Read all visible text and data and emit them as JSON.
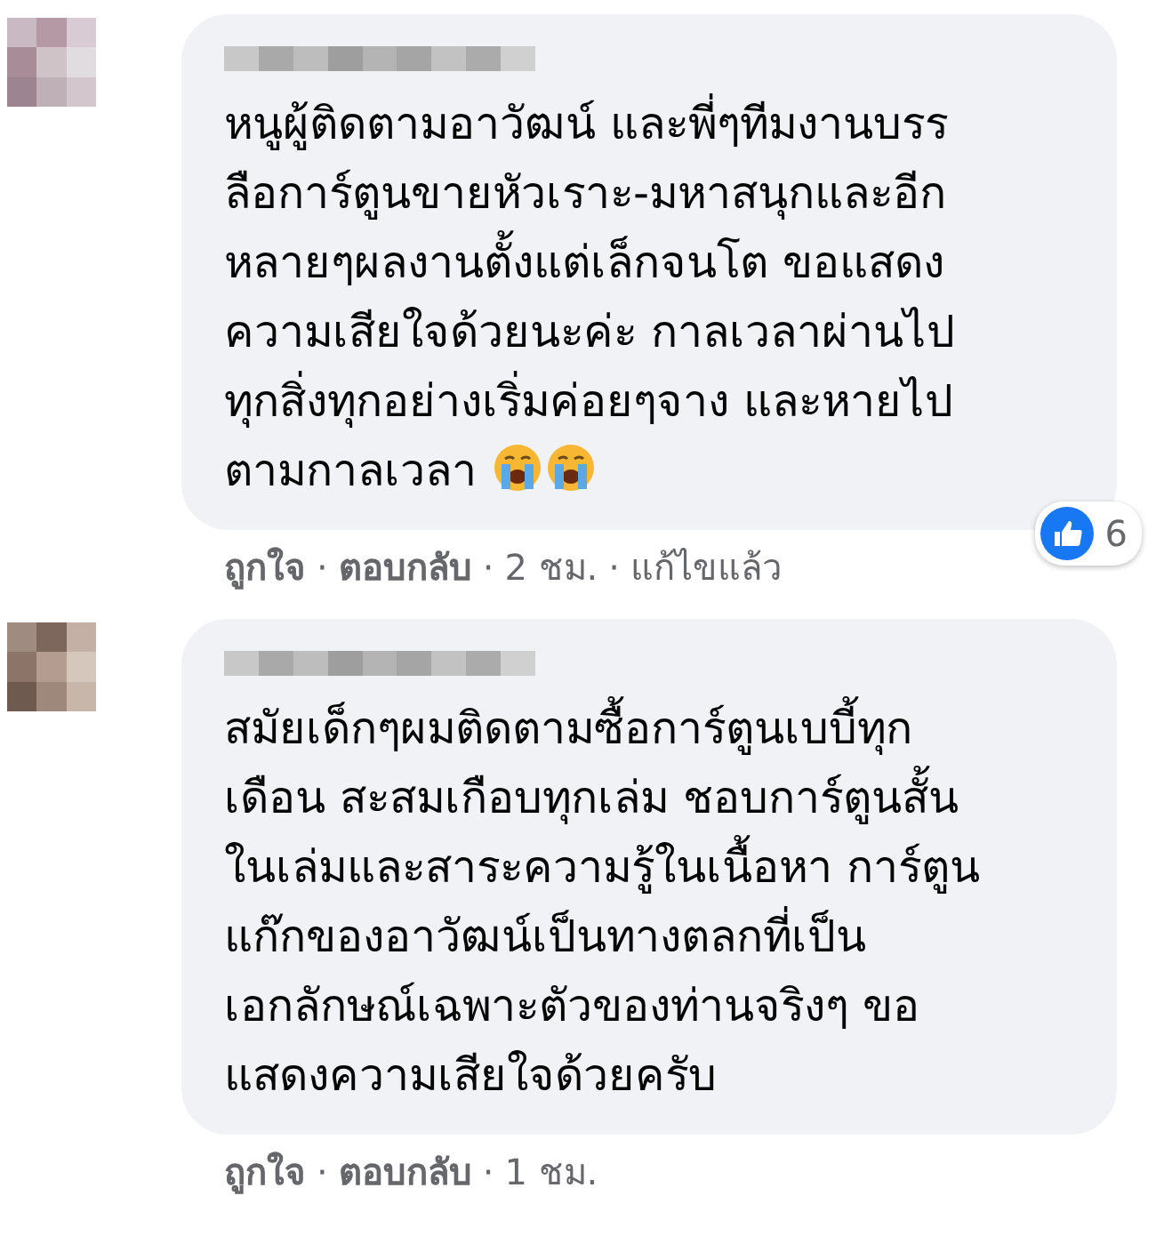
{
  "separator": "·",
  "comments": [
    {
      "avatar": {
        "kind": "picture"
      },
      "author_redacted": true,
      "lines": [
        "หนูผู้ติดตามอาวัฒน์ และพี่ๆทีมงานบรร",
        "ลือการ์ตูนขายหัวเราะ-มหาสนุกและอีก",
        "หลายๆผลงานตั้งแต่เล็กจนโต ขอแสดง",
        "ความเสียใจด้วยนะค่ะ กาลเวลาผ่านไป",
        "ทุกสิ่งทุกอย่างเริ่มค่อยๆจาง และหายไป",
        "ตามกาลเวลา"
      ],
      "emojis": [
        {
          "kind": "crying"
        },
        {
          "kind": "crying"
        }
      ],
      "reactions": {
        "count": "6"
      },
      "actions": [
        {
          "kind": "link",
          "label": "ถูกใจ"
        },
        {
          "kind": "link",
          "label": "ตอบกลับ"
        },
        {
          "kind": "time",
          "label": "2 ชม."
        },
        {
          "kind": "note",
          "label": "แก้ไขแล้ว"
        }
      ]
    },
    {
      "avatar": {
        "kind": "picture"
      },
      "author_redacted": true,
      "lines": [
        "สมัยเด็กๆผมติดตามซื้อการ์ตูนเบบี้ทุก",
        "เดือน สะสมเกือบทุกเล่ม ชอบการ์ตูนสั้น",
        "ในเล่มและสาระความรู้ในเนื้อหา การ์ตูน",
        "แก๊กของอาวัฒน์เป็นทางตลกที่เป็น",
        "เอกลักษณ์เฉพาะตัวของท่านจริงๆ ขอ",
        "แสดงความเสียใจด้วยครับ"
      ],
      "actions": [
        {
          "kind": "link",
          "label": "ถูกใจ"
        },
        {
          "kind": "link",
          "label": "ตอบกลับ"
        },
        {
          "kind": "time",
          "label": "1 ชม."
        }
      ]
    }
  ]
}
